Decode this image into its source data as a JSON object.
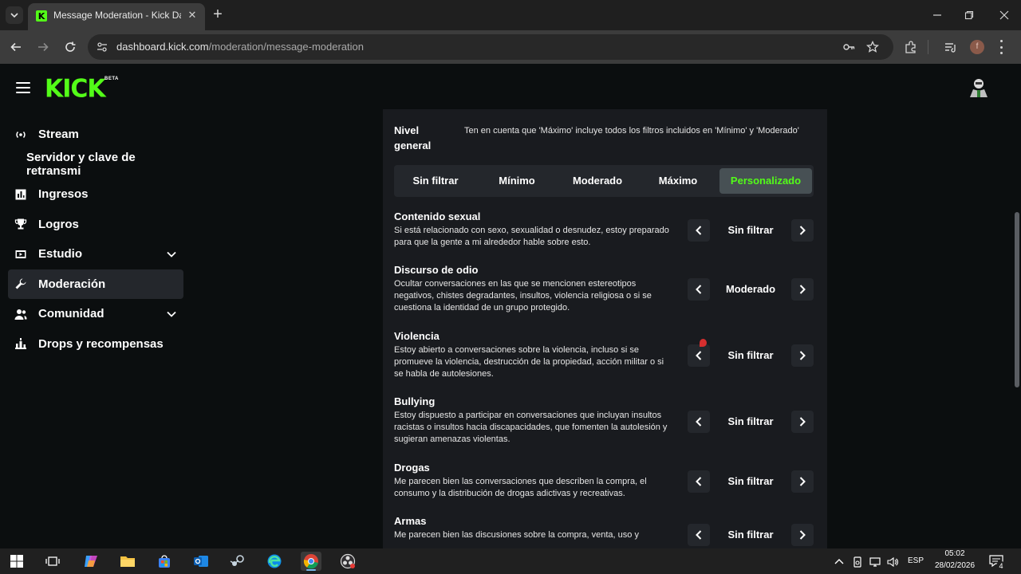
{
  "browser": {
    "tab_title": "Message Moderation - Kick Dashboard",
    "favicon_letter": "K",
    "url_host": "dashboard.kick.com",
    "url_path": "/moderation/message-moderation",
    "profile_letter": "f",
    "icons": [
      "tab-search-icon",
      "close-icon",
      "new-tab-icon",
      "minimize-icon",
      "restore-icon",
      "back-icon",
      "forward-icon",
      "reload-icon",
      "site-info-icon",
      "password-key-icon",
      "star-icon",
      "extensions-icon",
      "media-controls-icon",
      "menu-icon"
    ]
  },
  "header": {
    "logo": "KICK",
    "logo_badge": "BETA"
  },
  "sidebar": {
    "items": [
      {
        "label": "Stream",
        "icon": "broadcast-icon"
      },
      {
        "label": "Servidor y clave de retransmi",
        "icon": ""
      },
      {
        "label": "Ingresos",
        "icon": "bar-chart-icon"
      },
      {
        "label": "Logros",
        "icon": "trophy-icon"
      },
      {
        "label": "Estudio",
        "icon": "video-icon"
      },
      {
        "label": "Moderación",
        "icon": "wrench-icon"
      },
      {
        "label": "Comunidad",
        "icon": "users-icon"
      },
      {
        "label": "Drops y recompensas",
        "icon": "gift-chart-icon"
      }
    ]
  },
  "general_level": {
    "label": "Nivel general",
    "note": "Ten en cuenta que 'Máximo' incluye todos los filtros incluidos en 'Mínimo' y 'Moderado'",
    "tabs": [
      "Sin filtrar",
      "Mínimo",
      "Moderado",
      "Máximo",
      "Personalizado"
    ],
    "selected": "Personalizado",
    "accent_color": "#53fc18"
  },
  "categories": [
    {
      "title": "Contenido sexual",
      "description": "Si está relacionado con sexo, sexualidad o desnudez, estoy preparado para que la gente a mi alrededor hable sobre esto.",
      "value": "Sin filtrar"
    },
    {
      "title": "Discurso de odio",
      "description": "Ocultar conversaciones en las que se mencionen estereotipos negativos, chistes degradantes, insultos, violencia religiosa o si se cuestiona la identidad de un grupo protegido.",
      "value": "Moderado"
    },
    {
      "title": "Violencia",
      "description": "Estoy abierto a conversaciones sobre la violencia, incluso si se promueve la violencia, destrucción de la propiedad, acción militar o si se habla de autolesiones.",
      "value": "Sin filtrar"
    },
    {
      "title": "Bullying",
      "description": "Estoy dispuesto a participar en conversaciones que incluyan insultos racistas o insultos hacia discapacidades, que fomenten la autolesión y sugieran amenazas violentas.",
      "value": "Sin filtrar"
    },
    {
      "title": "Drogas",
      "description": "Me parecen bien las conversaciones que describen la compra, el consumo y la distribución de drogas adictivas y recreativas.",
      "value": "Sin filtrar"
    },
    {
      "title": "Armas",
      "description": "Me parecen bien las discusiones sobre la compra, venta, uso y",
      "value": "Sin filtrar"
    }
  ],
  "taskbar": {
    "apps": [
      "windows-start-icon",
      "task-view-icon",
      "copilot-icon",
      "file-explorer-icon",
      "store-icon",
      "outlook-icon",
      "steam-icon",
      "edge-icon",
      "chrome-icon",
      "obs-icon"
    ],
    "language": "ESP",
    "time": "05:02",
    "date": "28/02/2026",
    "notification_count": "4"
  }
}
